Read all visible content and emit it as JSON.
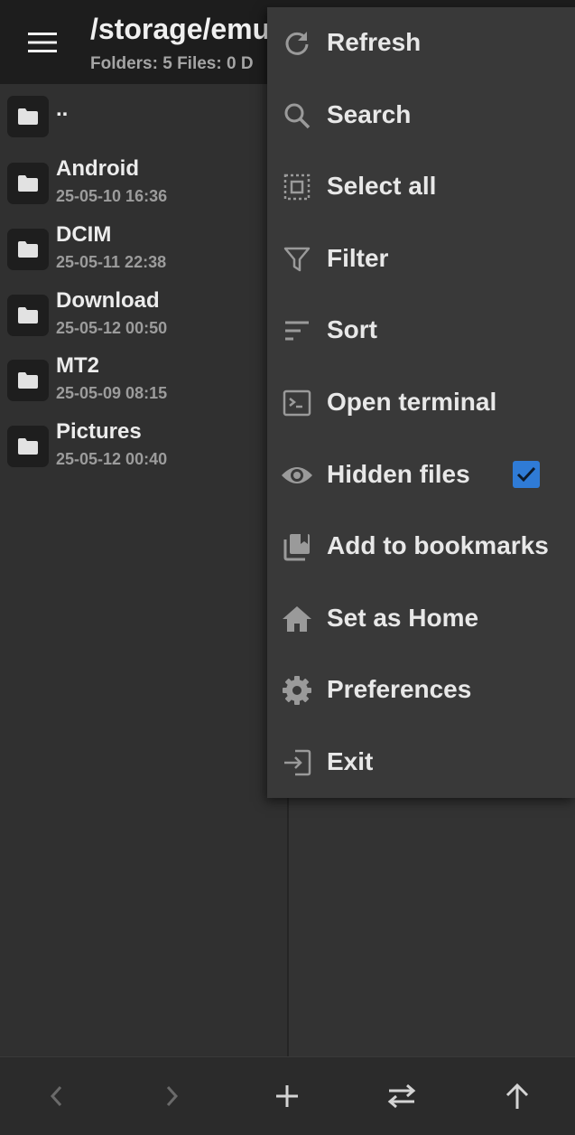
{
  "header": {
    "path": "/storage/emu",
    "info": "Folders: 5  Files: 0  D"
  },
  "files": [
    {
      "name": "..",
      "date": ""
    },
    {
      "name": "Android",
      "date": "25-05-10 16:36"
    },
    {
      "name": "DCIM",
      "date": "25-05-11 22:38"
    },
    {
      "name": "Download",
      "date": "25-05-12 00:50"
    },
    {
      "name": "MT2",
      "date": "25-05-09 08:15"
    },
    {
      "name": "Pictures",
      "date": "25-05-12 00:40"
    }
  ],
  "menu": {
    "items": [
      {
        "label": "Refresh",
        "icon": "refresh-icon"
      },
      {
        "label": "Search",
        "icon": "search-icon"
      },
      {
        "label": "Select all",
        "icon": "select-all-icon"
      },
      {
        "label": "Filter",
        "icon": "filter-icon"
      },
      {
        "label": "Sort",
        "icon": "sort-icon"
      },
      {
        "label": "Open terminal",
        "icon": "terminal-icon"
      },
      {
        "label": "Hidden files",
        "icon": "eye-icon",
        "checked": true
      },
      {
        "label": "Add to bookmarks",
        "icon": "bookmarks-icon"
      },
      {
        "label": "Set as Home",
        "icon": "home-icon"
      },
      {
        "label": "Preferences",
        "icon": "gear-icon"
      },
      {
        "label": "Exit",
        "icon": "exit-icon"
      }
    ]
  },
  "bottom_nav": [
    "back-icon",
    "forward-icon",
    "add-icon",
    "swap-icon",
    "up-icon"
  ],
  "colors": {
    "checkbox_accent": "#2f7bd6",
    "background": "#2f2f2f",
    "topbar": "#1d1d1d",
    "menu_background": "#393939"
  }
}
